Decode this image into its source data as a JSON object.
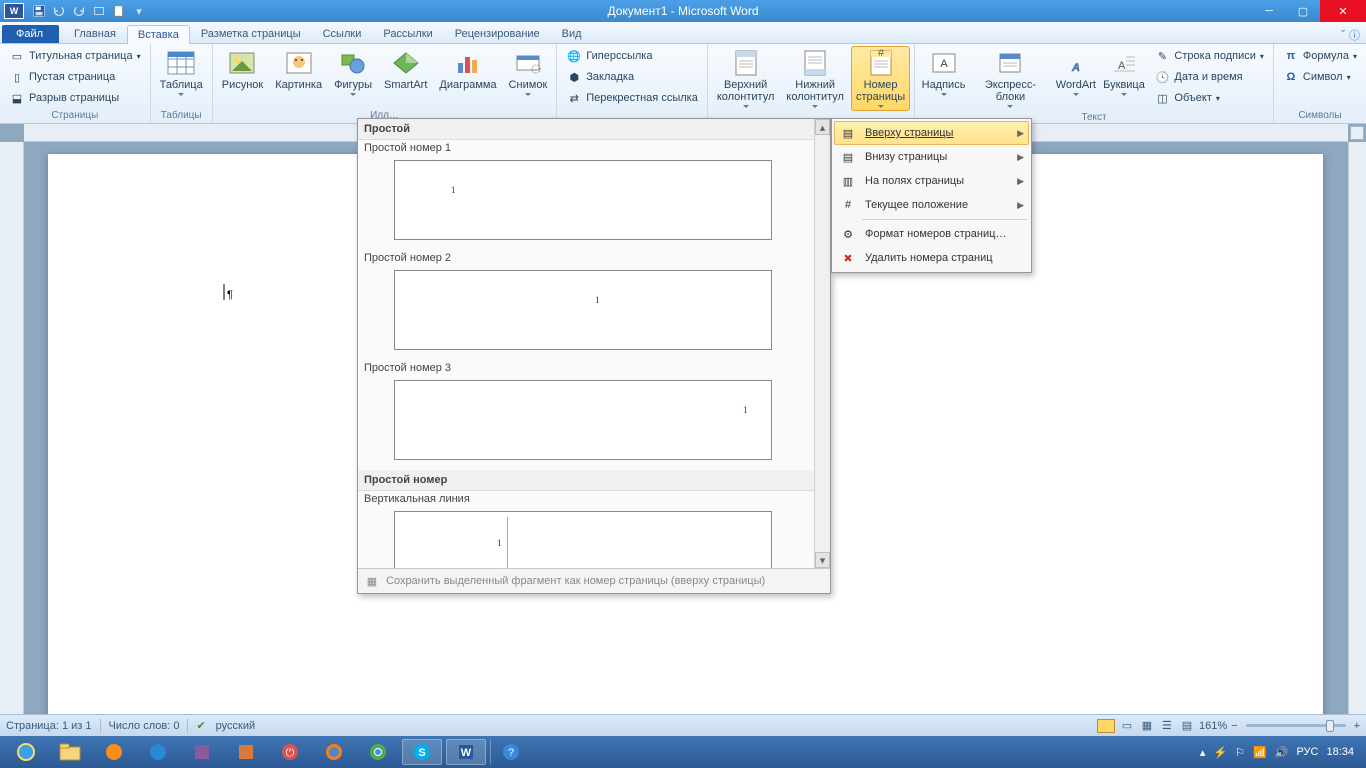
{
  "window": {
    "title": "Документ1 - Microsoft Word"
  },
  "tabs": {
    "file": "Файл",
    "home": "Главная",
    "insert": "Вставка",
    "layout": "Разметка страницы",
    "references": "Ссылки",
    "mailings": "Рассылки",
    "review": "Рецензирование",
    "view": "Вид"
  },
  "ribbon": {
    "pages": {
      "cover": "Титульная страница",
      "blank": "Пустая страница",
      "break": "Разрыв страницы",
      "label": "Страницы"
    },
    "tables": {
      "btn": "Таблица",
      "label": "Таблицы"
    },
    "illus": {
      "picture": "Рисунок",
      "clipart": "Картинка",
      "shapes": "Фигуры",
      "smartart": "SmartArt",
      "chart": "Диаграмма",
      "screenshot": "Снимок",
      "label": "Илл…"
    },
    "links": {
      "hyperlink": "Гиперссылка",
      "bookmark": "Закладка",
      "crossref": "Перекрестная ссылка"
    },
    "headerfooter": {
      "header": "Верхний\nколонтитул",
      "footer": "Нижний\nколонтитул",
      "pagenum": "Номер\nстраницы"
    },
    "text": {
      "textbox": "Надпись",
      "quickparts": "Экспресс-блоки",
      "wordart": "WordArt",
      "dropcap": "Буквица",
      "signature": "Строка подписи",
      "datetime": "Дата и время",
      "object": "Объект",
      "label": "Текст"
    },
    "symbols": {
      "equation": "Формула",
      "symbol": "Символ",
      "label": "Символы"
    }
  },
  "submenu": {
    "top": "Вверху страницы",
    "bottom": "Внизу страницы",
    "margins": "На полях страницы",
    "current": "Текущее положение",
    "format": "Формат номеров страниц…",
    "remove": "Удалить номера страниц"
  },
  "gallery": {
    "section1": "Простой",
    "item1": "Простой номер 1",
    "item2": "Простой номер 2",
    "item3": "Простой номер 3",
    "section2": "Простой номер",
    "item4": "Вертикальная линия",
    "num": "1",
    "footer": "Сохранить выделенный фрагмент как номер страницы (вверху страницы)"
  },
  "status": {
    "page": "Страница: 1 из 1",
    "words": "Число слов: 0",
    "lang": "русский",
    "zoom": "161%"
  },
  "taskbar": {
    "lang": "РУС",
    "time": "18:34"
  }
}
